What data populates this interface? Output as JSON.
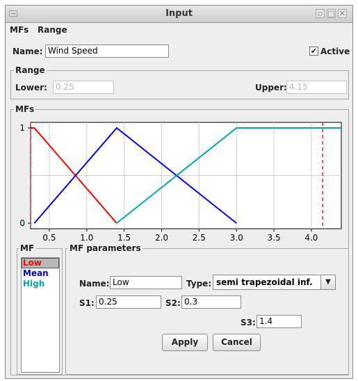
{
  "window": {
    "title": "Input"
  },
  "menu": {
    "items": [
      "MFs",
      "Range"
    ]
  },
  "input": {
    "name_label": "Name:",
    "name_value": "Wind Speed",
    "active_label": "Active",
    "active_checked": true
  },
  "range": {
    "title": "Range",
    "lower_label": "Lower:",
    "lower_value": "0.25",
    "upper_label": "Upper:",
    "upper_value": "4.15"
  },
  "mfs": {
    "title": "MFs"
  },
  "chart_data": {
    "type": "line",
    "xlim": [
      0.25,
      4.4
    ],
    "ylim": [
      0,
      1
    ],
    "xticks": [
      "0.5",
      "1.0",
      "1.5",
      "2.0",
      "2.5",
      "3.0",
      "3.5",
      "4.0"
    ],
    "xtick_values": [
      0.5,
      1.0,
      1.5,
      2.0,
      2.5,
      3.0,
      3.5,
      4.0
    ],
    "yticks": [
      "0",
      "1"
    ],
    "ytick_values": [
      0,
      1
    ],
    "grid": true,
    "series": [
      {
        "name": "Low",
        "color": "#ff0000",
        "x": [
          0.15,
          0.3,
          1.4
        ],
        "y": [
          1,
          1,
          0
        ]
      },
      {
        "name": "Mean",
        "color": "#0000ff",
        "x": [
          0.3,
          1.4,
          3.0
        ],
        "y": [
          0,
          1,
          0
        ]
      },
      {
        "name": "High",
        "color": "#00aaaa",
        "x": [
          1.4,
          3.0,
          4.4
        ],
        "y": [
          0,
          1,
          1
        ]
      }
    ],
    "range_markers": [
      0.25,
      4.15
    ],
    "range_marker_color": "#ff0000"
  },
  "mf_list": {
    "title": "MF",
    "items": [
      {
        "label": "Low",
        "color": "#ff0000",
        "selected": true
      },
      {
        "label": "Mean",
        "color": "#0000cc",
        "selected": false
      },
      {
        "label": "High",
        "color": "#00aaaa",
        "selected": false
      }
    ]
  },
  "mf_params": {
    "title": "MF parameters",
    "name_label": "Name:",
    "name_value": "Low",
    "type_label": "Type:",
    "type_value": "semi trapezoidal inf.",
    "s1_label": "S1:",
    "s1_value": "0.25",
    "s2_label": "S2:",
    "s2_value": "0.3",
    "s3_label": "S3:",
    "s3_value": "1.4",
    "apply_label": "Apply",
    "cancel_label": "Cancel"
  }
}
